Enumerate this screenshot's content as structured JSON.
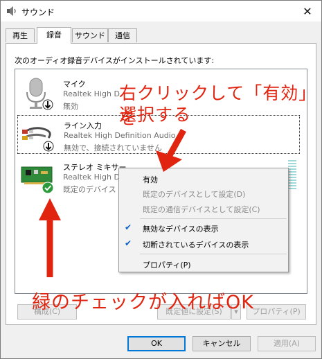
{
  "window": {
    "title": "サウンド",
    "close_glyph": "✕"
  },
  "tabs": [
    {
      "label": "再生"
    },
    {
      "label": "録音"
    },
    {
      "label": "サウンド"
    },
    {
      "label": "通信"
    }
  ],
  "instruction": "次のオーディオ録音デバイスがインストールされています:",
  "devices": [
    {
      "name": "マイク",
      "driver": "Realtek High D",
      "status": "無効"
    },
    {
      "name": "ライン入力",
      "driver": "Realtek High Definition Audio",
      "status": "無効で、接続されていません"
    },
    {
      "name": "ステレオ ミキサー",
      "driver": "Realtek High D",
      "status": "既定のデバイス"
    }
  ],
  "context_menu": {
    "items": [
      {
        "label": "有効",
        "enabled": true
      },
      {
        "label": "既定のデバイスとして設定(D)",
        "enabled": false
      },
      {
        "label": "既定の通信デバイスとして設定(C)",
        "enabled": false
      },
      {
        "label": "無効なデバイスの表示",
        "checked": true
      },
      {
        "label": "切断されているデバイスの表示",
        "checked": true
      },
      {
        "label": "プロパティ(P)",
        "enabled": true
      }
    ]
  },
  "panel_buttons": {
    "configure": "構成(C)",
    "set_default": "既定値に設定(S)",
    "properties": "プロパティ(P)"
  },
  "dialog_buttons": {
    "ok": "OK",
    "cancel": "キャンセル",
    "apply": "適用(A)"
  },
  "annotations": {
    "line1": "右クリックして「有効」を",
    "line2": "選択する",
    "bottom": "緑のチェックが入ればOK",
    "color": "#e02410"
  },
  "icons": {
    "app": "speaker-icon",
    "mic": "microphone-icon",
    "line_in": "audio-cable-icon",
    "stereo_mix": "sound-card-icon",
    "disabled_badge": "down-arrow-badge-icon",
    "default_badge": "green-check-icon",
    "check": "checkmark-icon"
  }
}
